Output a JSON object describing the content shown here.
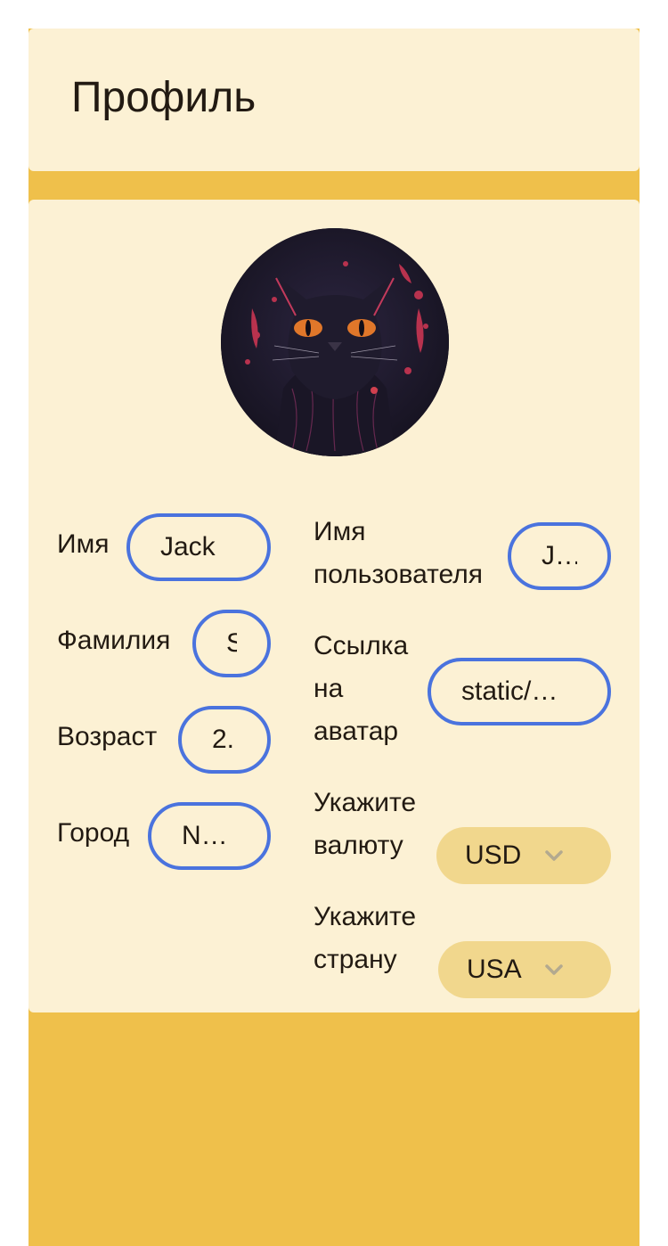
{
  "header": {
    "title": "Профиль"
  },
  "profile": {
    "avatar_icon": "cat-avatar-image",
    "fields_left": [
      {
        "label": "Имя",
        "value": "Jack"
      },
      {
        "label": "Фамилия",
        "value": "S"
      },
      {
        "label": "Возраст",
        "value": "2."
      },
      {
        "label": "Город",
        "value": "N…"
      }
    ],
    "username": {
      "label_line1": "Имя",
      "label_line2": "пользователя",
      "value": "J…"
    },
    "avatar_link": {
      "label_line1": "Ссылка",
      "label_line2": "на",
      "label_line3": "аватар",
      "value": "static/…"
    },
    "currency": {
      "label_line1": "Укажите",
      "label_line2": "валюту",
      "value": "USD",
      "icon": "chevron-down-icon"
    },
    "country": {
      "label_line1": "Укажите",
      "label_line2": "страну",
      "value": "USA",
      "icon": "chevron-down-icon"
    }
  },
  "colors": {
    "page_bg": "#efc04b",
    "card_bg": "#fcf1d4",
    "input_border": "#4a73de",
    "select_bg": "#f1d78d"
  }
}
